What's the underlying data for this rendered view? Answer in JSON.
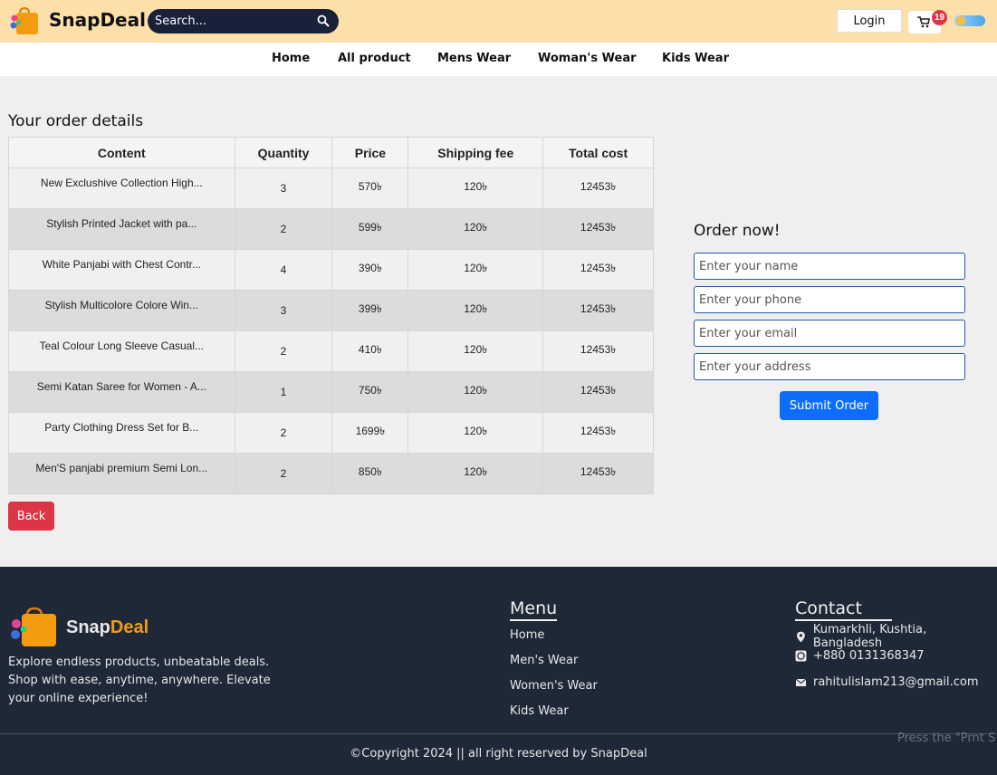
{
  "header": {
    "brand_name": "SnapDeal",
    "search_placeholder": "Search...",
    "login_label": "Login",
    "cart_count": "19"
  },
  "nav": {
    "items": [
      "Home",
      "All product",
      "Mens Wear",
      "Woman's Wear",
      "Kids Wear"
    ]
  },
  "order": {
    "title": "Your order details",
    "columns": [
      "Content",
      "Quantity",
      "Price",
      "Shipping fee",
      "Total cost"
    ],
    "rows": [
      {
        "content": "New Exclushive Collection High...",
        "quantity": "3",
        "price": "570৳",
        "shipping": "120৳",
        "total": "12453৳"
      },
      {
        "content": "Stylish Printed Jacket with pa...",
        "quantity": "2",
        "price": "599৳",
        "shipping": "120৳",
        "total": "12453৳"
      },
      {
        "content": "White Panjabi with Chest Contr...",
        "quantity": "4",
        "price": "390৳",
        "shipping": "120৳",
        "total": "12453৳"
      },
      {
        "content": "Stylish Multicolore Colore Win...",
        "quantity": "3",
        "price": "399৳",
        "shipping": "120৳",
        "total": "12453৳"
      },
      {
        "content": "Teal Colour Long Sleeve Casual...",
        "quantity": "2",
        "price": "410৳",
        "shipping": "120৳",
        "total": "12453৳"
      },
      {
        "content": "Semi Katan Saree for Women - A...",
        "quantity": "1",
        "price": "750৳",
        "shipping": "120৳",
        "total": "12453৳"
      },
      {
        "content": "Party Clothing Dress Set for B...",
        "quantity": "2",
        "price": "1699৳",
        "shipping": "120৳",
        "total": "12453৳"
      },
      {
        "content": "Men'S panjabi premium Semi Lon...",
        "quantity": "2",
        "price": "850৳",
        "shipping": "120৳",
        "total": "12453৳"
      }
    ],
    "back_label": "Back"
  },
  "form": {
    "title": "Order now!",
    "name_placeholder": "Enter your name",
    "phone_placeholder": "Enter your phone",
    "email_placeholder": "Enter your email",
    "address_placeholder": "Enter your address",
    "submit_label": "Submit Order"
  },
  "footer": {
    "brand_snap": "Snap",
    "brand_deal": "Deal",
    "description": "Explore endless products, unbeatable deals. Shop with ease, anytime, anywhere. Elevate your online experience!",
    "menu_heading": "Menu",
    "menu_items": [
      "Home",
      "Men's Wear",
      "Women's Wear",
      "Kids Wear"
    ],
    "contact_heading": "Contact",
    "address": "Kumarkhli, Kushtia, Bangladesh",
    "phone": "+880 0131368347",
    "email": "rahitulislam213@gmail.com",
    "copyright": "©Copyright 2024 || all right reserved by SnapDeal",
    "watermark": "Press the \"Prnt S screenshot"
  },
  "colors": {
    "header_bg": "#fddfa9",
    "footer_bg": "#1f2837",
    "primary": "#0d6efd",
    "danger": "#dc3545",
    "accent": "#f39c12"
  },
  "icons": [
    "shopping-bag-logo-icon",
    "search-icon",
    "cart-icon",
    "theme-toggle-icon",
    "location-icon",
    "whatsapp-icon",
    "mail-icon"
  ]
}
